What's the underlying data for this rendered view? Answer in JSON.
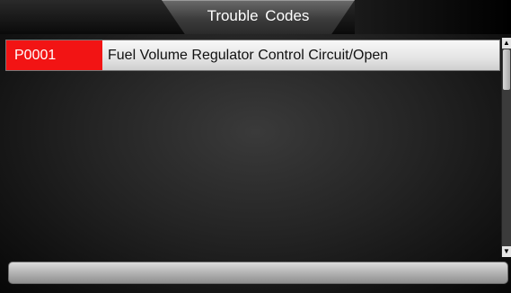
{
  "header": {
    "title": "Trouble  Codes"
  },
  "dtc_list": [
    {
      "code": "P0001",
      "description": "Fuel Volume Regulator Control Circuit/Open"
    }
  ],
  "scrollbar": {
    "up_icon": "▲",
    "down_icon": "▼"
  },
  "colors": {
    "code_highlight": "#f21414",
    "background": "#242424"
  }
}
